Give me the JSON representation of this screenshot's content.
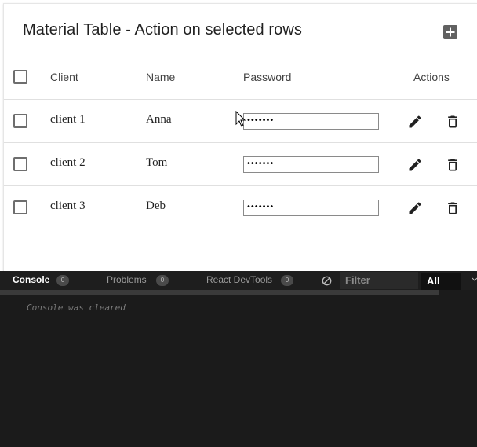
{
  "table": {
    "title": "Material Table - Action on selected rows",
    "columns": {
      "client": "Client",
      "name": "Name",
      "password": "Password",
      "actions": "Actions"
    },
    "rows": [
      {
        "client": "client 1",
        "name": "Anna",
        "password": "•••••••"
      },
      {
        "client": "client 2",
        "name": "Tom",
        "password": "•••••••"
      },
      {
        "client": "client 3",
        "name": "Deb",
        "password": "•••••••"
      }
    ],
    "icons": {
      "add": "add-box-icon",
      "edit": "pencil-icon",
      "delete": "trash-icon"
    }
  },
  "console": {
    "tabs": [
      {
        "label": "Console",
        "count": "0"
      },
      {
        "label": "Problems",
        "count": "0"
      },
      {
        "label": "React DevTools",
        "count": "0"
      }
    ],
    "filter_placeholder": "Filter",
    "level": "All",
    "message": "Console was cleared"
  },
  "colors": {
    "console_bg": "#1b1b1b",
    "card_bg": "#ffffff",
    "icon": "#212121"
  }
}
